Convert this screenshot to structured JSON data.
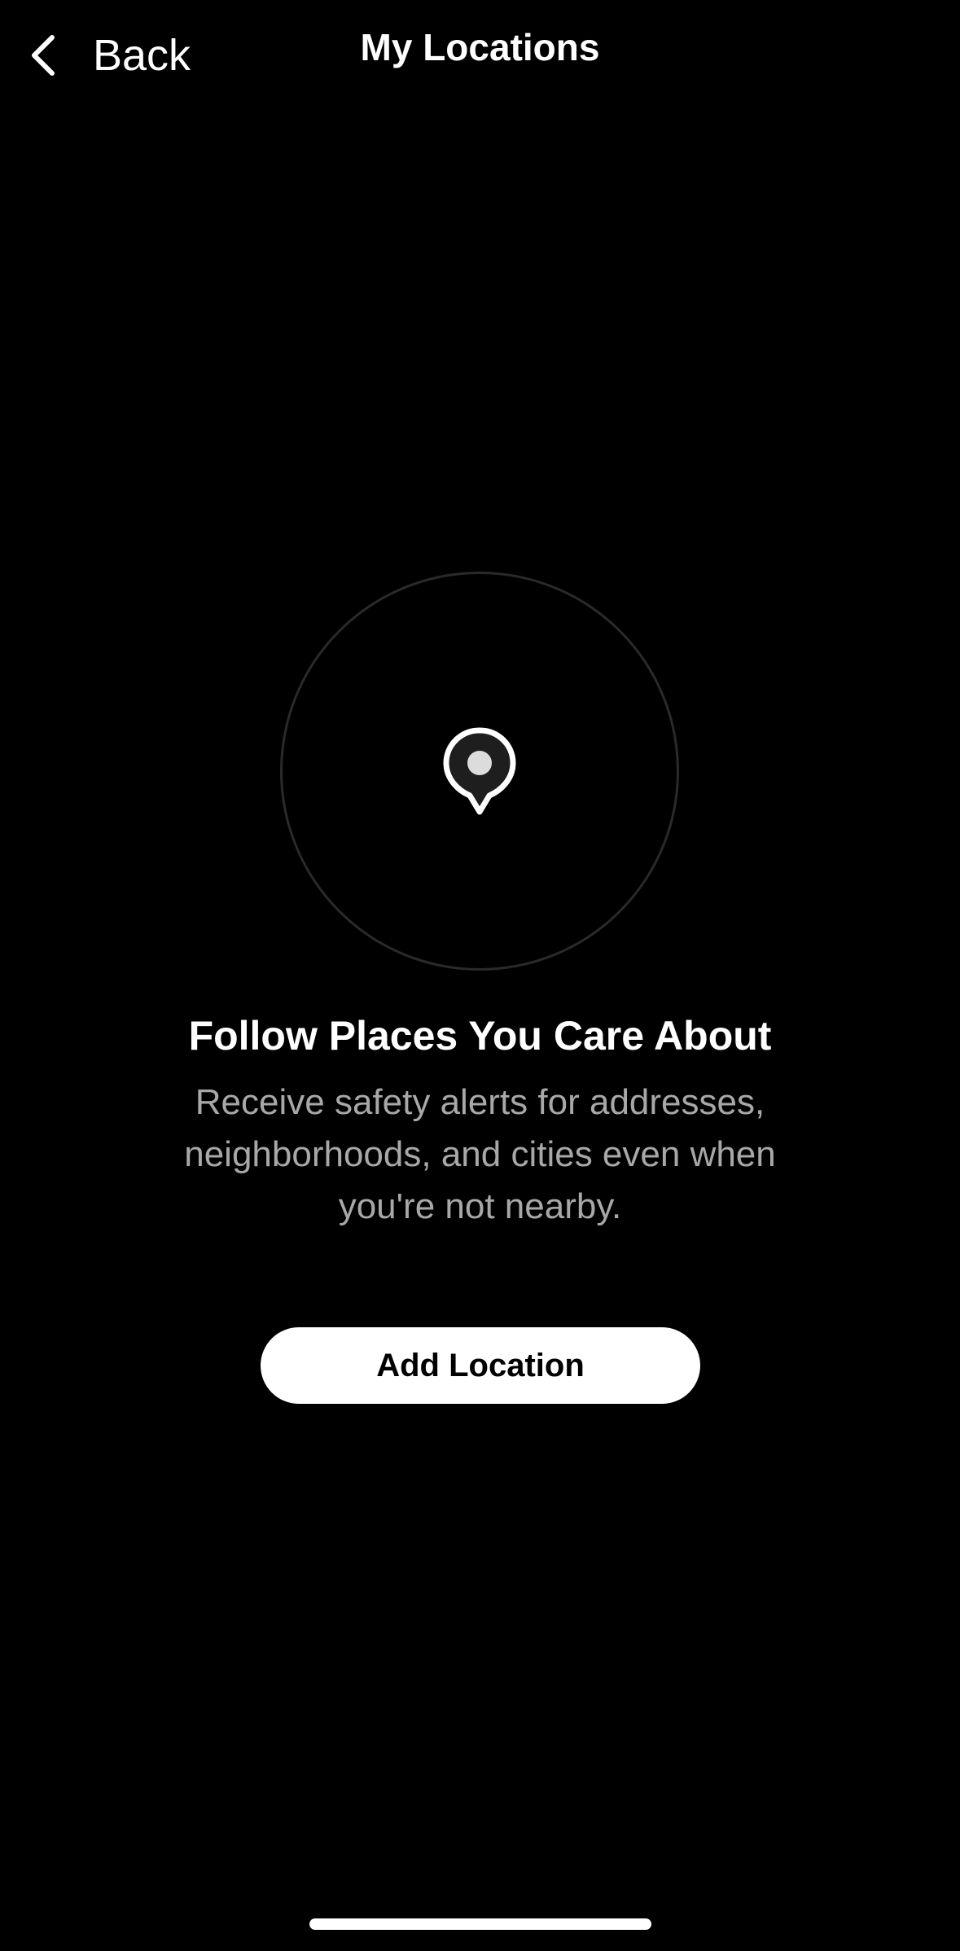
{
  "nav": {
    "back_label": "Back",
    "back_icon": "chevron-left-icon",
    "title": "My Locations"
  },
  "empty_state": {
    "icon": "location-pin-icon",
    "headline": "Follow Places You Care About",
    "description": "Receive safety alerts for addresses, neighborhoods, and cities even when you're not nearby.",
    "button_label": "Add Location"
  },
  "colors": {
    "background": "#000000",
    "text_primary": "#ffffff",
    "text_secondary": "#a8a8a8",
    "circle_border": "#2a2a2a",
    "button_bg": "#ffffff",
    "button_text": "#000000"
  }
}
